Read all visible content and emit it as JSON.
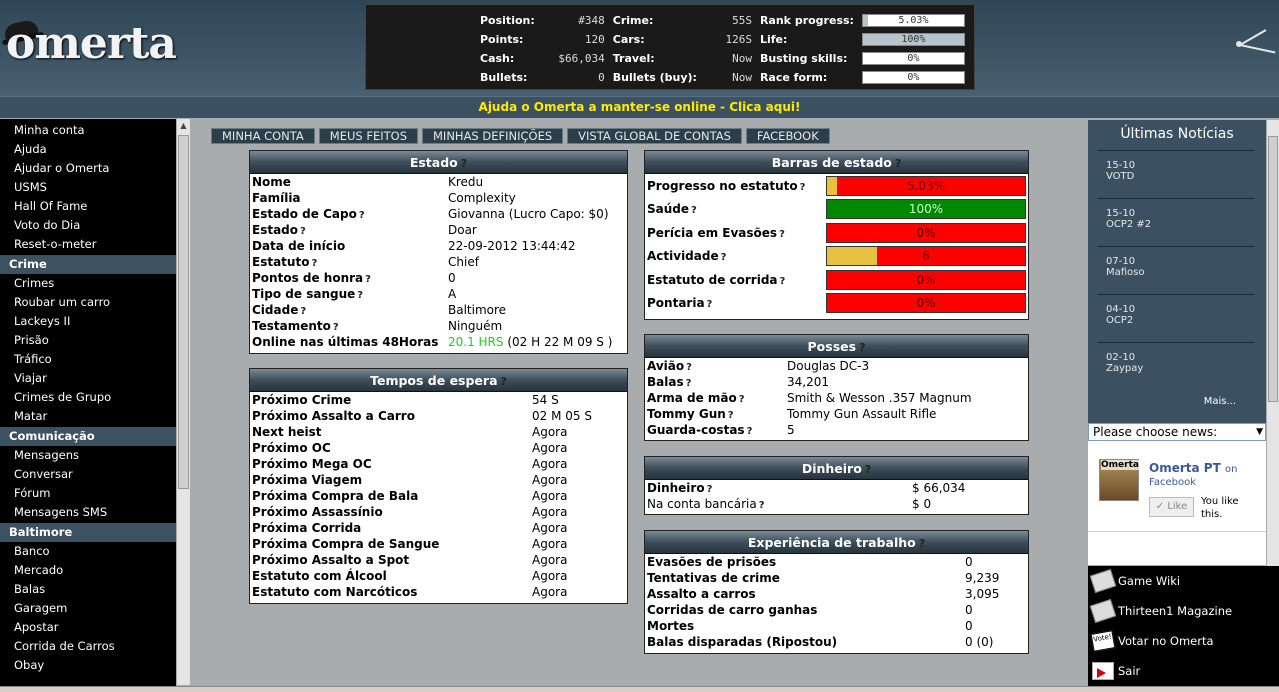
{
  "logo": {
    "text": "omerta"
  },
  "stats": {
    "rows": [
      {
        "c1l": "Position:",
        "c1v": "#348",
        "c2l": "Crime:",
        "c2v": "55S",
        "c3l": "Rank progress:",
        "c3v": "5.03%",
        "c3f": 5.03
      },
      {
        "c1l": "Points:",
        "c1v": "120",
        "c2l": "Cars:",
        "c2v": "126S",
        "c3l": "Life:",
        "c3v": "100%",
        "c3f": 100
      },
      {
        "c1l": "Cash:",
        "c1v": "$66,034",
        "c2l": "Travel:",
        "c2v": "Now",
        "c3l": "Busting skills:",
        "c3v": "0%",
        "c3f": 0
      },
      {
        "c1l": "Bullets:",
        "c1v": "0",
        "c2l": "Bullets (buy):",
        "c2v": "Now",
        "c3l": "Race form:",
        "c3v": "0%",
        "c3f": 0
      }
    ]
  },
  "banner": {
    "text": "Ajuda o Omerta a manter-se online - Clica aqui!"
  },
  "nav": {
    "top_items": [
      "Minha conta",
      "Ajuda",
      "Ajudar o Omerta",
      "USMS",
      "Hall Of Fame",
      "Voto do Dia",
      "Reset-o-meter"
    ],
    "crime_title": "Crime",
    "crime_items": [
      "Crimes",
      "Roubar um carro",
      "Lackeys II",
      "Prisão",
      "Tráfico",
      "Viajar",
      "Crimes de Grupo",
      "Matar"
    ],
    "comm_title": "Comunicação",
    "comm_items": [
      "Mensagens",
      "Conversar",
      "Fórum",
      "Mensagens SMS"
    ],
    "city_title": "Baltimore",
    "city_items": [
      "Banco",
      "Mercado",
      "Balas",
      "Garagem",
      "Apostar",
      "Corrida de Carros",
      "Obay"
    ]
  },
  "tabs": [
    "MINHA CONTA",
    "MEUS FEITOS",
    "MINHAS DEFINIÇÕES",
    "VISTA GLOBAL DE CONTAS",
    "FACEBOOK"
  ],
  "estado": {
    "title": "Estado",
    "rows": [
      {
        "k": "Nome",
        "v": "Kredu",
        "q": false
      },
      {
        "k": "Família",
        "v": "Complexity",
        "q": false
      },
      {
        "k": "Estado de Capo",
        "v": "Giovanna (Lucro Capo: $0)",
        "q": true
      },
      {
        "k": "Estado",
        "v": "Doar",
        "q": true
      },
      {
        "k": "Data de início",
        "v": "22-09-2012 13:44:42",
        "q": false
      },
      {
        "k": "Estatuto",
        "v": "Chief",
        "q": true
      },
      {
        "k": "Pontos de honra",
        "v": "0",
        "q": true
      },
      {
        "k": "Tipo de sangue",
        "v": "A",
        "q": true
      },
      {
        "k": "Cidade",
        "v": "Baltimore",
        "q": true
      },
      {
        "k": "Testamento",
        "v": "Ninguém",
        "q": true
      }
    ],
    "online_label": "Online nas últimas 48Horas",
    "online_hrs": "20.1 HRS",
    "online_time": "(02 H 22 M 09 S )"
  },
  "tempos": {
    "title": "Tempos de espera",
    "rows": [
      {
        "k": "Próximo Crime",
        "v": "54 S"
      },
      {
        "k": "Próximo Assalto a Carro",
        "v": "02 M 05 S"
      },
      {
        "k": "Next heist",
        "v": "Agora"
      },
      {
        "k": "Próximo OC",
        "v": "Agora"
      },
      {
        "k": "Próximo Mega OC",
        "v": "Agora"
      },
      {
        "k": "Próxima Viagem",
        "v": "Agora"
      },
      {
        "k": "Próxima Compra de Bala",
        "v": "Agora"
      },
      {
        "k": "Próximo Assassínio",
        "v": "Agora"
      },
      {
        "k": "Próxima Corrida",
        "v": "Agora"
      },
      {
        "k": "Próxima Compra de Sangue",
        "v": "Agora"
      },
      {
        "k": "Próximo Assalto a Spot",
        "v": "Agora"
      },
      {
        "k": "Estatuto com Álcool",
        "v": "Agora"
      },
      {
        "k": "Estatuto com Narcóticos",
        "v": "Agora"
      }
    ]
  },
  "barras": {
    "title": "Barras de estado",
    "rows": [
      {
        "k": "Progresso no estatuto",
        "pct": "5.03%",
        "fill": 5.03,
        "color": "#e8c040"
      },
      {
        "k": "Saúde",
        "pct": "100%",
        "fill": 100,
        "color": "#008800"
      },
      {
        "k": "Perícia em Evasões",
        "pct": "0%",
        "fill": 0,
        "color": "#e8c040"
      },
      {
        "k": "Actividade",
        "pct": "6",
        "fill": 25,
        "color": "#e8c040"
      },
      {
        "k": "Estatuto de corrida",
        "pct": "0%",
        "fill": 0,
        "color": "#e8c040"
      },
      {
        "k": "Pontaria",
        "pct": "0%",
        "fill": 0,
        "color": "#e8c040"
      }
    ]
  },
  "posses": {
    "title": "Posses",
    "rows": [
      {
        "k": "Avião",
        "v": "Douglas DC-3"
      },
      {
        "k": "Balas",
        "v": "34,201"
      },
      {
        "k": "Arma de mão",
        "v": "Smith & Wesson .357 Magnum"
      },
      {
        "k": "Tommy Gun",
        "v": "Tommy Gun Assault Rifle"
      },
      {
        "k": "Guarda-costas",
        "v": "5"
      }
    ]
  },
  "dinheiro": {
    "title": "Dinheiro",
    "rows": [
      {
        "k": "Dinheiro",
        "v": "$ 66,034",
        "bold": true
      },
      {
        "k": "Na conta bancária",
        "v": "$ 0",
        "bold": false
      }
    ]
  },
  "experiencia": {
    "title": "Experiência de trabalho",
    "rows": [
      {
        "k": "Evasões de prisões",
        "v": "0"
      },
      {
        "k": "Tentativas de crime",
        "v": "9,239"
      },
      {
        "k": "Assalto a carros",
        "v": "3,095"
      },
      {
        "k": "Corridas de carro ganhas",
        "v": "0"
      },
      {
        "k": "Mortes",
        "v": "0"
      },
      {
        "k": "Balas disparadas (Ripostou)",
        "v": "0 (0)"
      }
    ]
  },
  "news": {
    "title": "Últimas Notícias",
    "items": [
      {
        "date": "15-10",
        "text": "VOTD"
      },
      {
        "date": "15-10",
        "text": "OCP2 #2"
      },
      {
        "date": "07-10",
        "text": "Mafioso"
      },
      {
        "date": "04-10",
        "text": "OCP2"
      },
      {
        "date": "02-10",
        "text": "Zaypay"
      }
    ],
    "more": "Mais...",
    "select": "Please choose news:"
  },
  "facebook": {
    "avatar_text": "Omerta",
    "name": "Omerta PT",
    "on": "on",
    "fb": "Facebook",
    "like": "Like",
    "youlike": "You like this."
  },
  "bottom_links": [
    "Game Wiki",
    "Thirteen1 Magazine",
    "Votar no Omerta",
    "Sair"
  ],
  "vote_icon_text": "Vote!"
}
